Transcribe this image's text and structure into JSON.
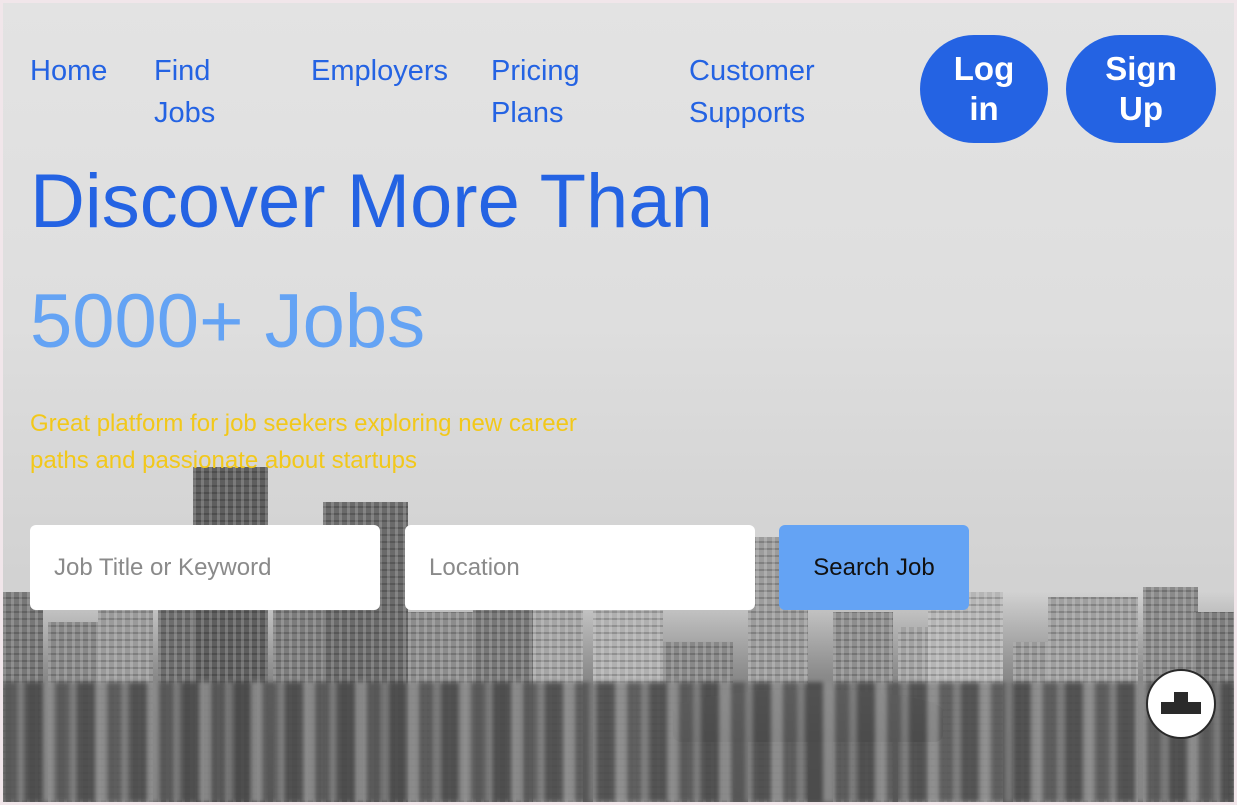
{
  "nav": {
    "items": [
      {
        "label": "Home"
      },
      {
        "label": "Find Jobs"
      },
      {
        "label": "Employers"
      },
      {
        "label": "Pricing Plans"
      },
      {
        "label": "Customer Supports"
      }
    ],
    "login_label": "Log in",
    "signup_label": "Sign Up"
  },
  "hero": {
    "title": "Discover More Than",
    "count": "5000+ Jobs",
    "subtitle": "Great platform for job seekers exploring new career paths and passionate about startups"
  },
  "search": {
    "job_placeholder": "Job Title or Keyword",
    "location_placeholder": "Location",
    "button_label": "Search Job"
  },
  "widget": {
    "icon": "stairs-logo-icon"
  },
  "colors": {
    "primary": "#2463e3",
    "accent_light": "#64a3f4",
    "subtitle": "#f2c81a",
    "button_bg": "#64a3f4"
  }
}
